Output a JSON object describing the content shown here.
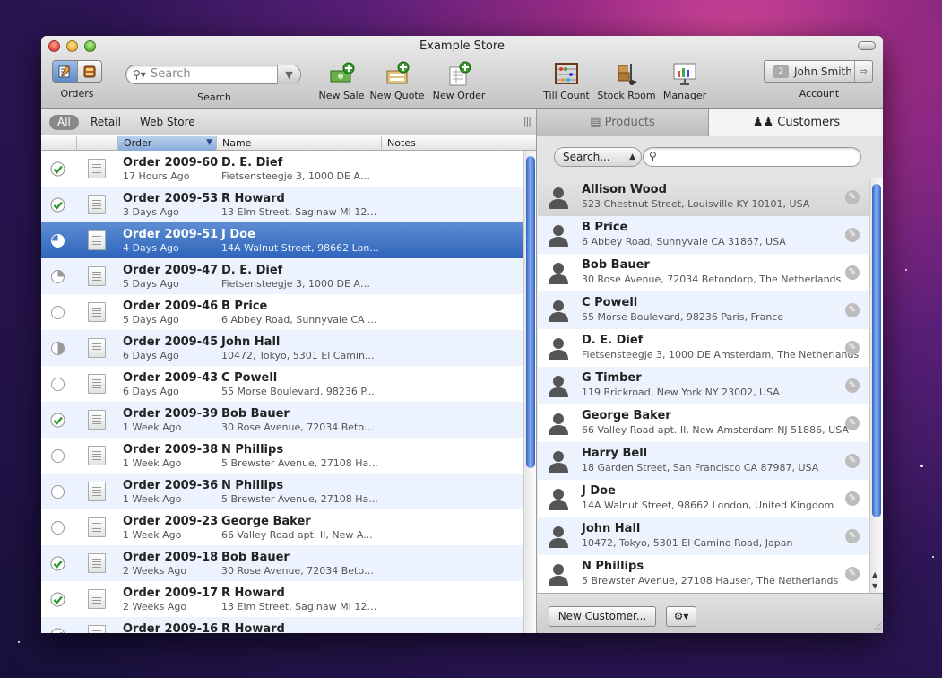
{
  "window": {
    "title": "Example Store"
  },
  "toolbar": {
    "orders_label": "Orders",
    "search_label": "Search",
    "search_placeholder": "Search",
    "new_sale_label": "New Sale",
    "new_quote_label": "New Quote",
    "new_order_label": "New Order",
    "till_count_label": "Till Count",
    "stock_room_label": "Stock Room",
    "manager_label": "Manager",
    "account_label": "Account",
    "account_user": "John Smith",
    "account_badge": "2"
  },
  "scope_bar": {
    "all": "All",
    "retail": "Retail",
    "web_store": "Web Store"
  },
  "orders_table": {
    "columns": {
      "order": "Order",
      "name": "Name",
      "notes": "Notes"
    },
    "rows": [
      {
        "status": "complete",
        "order": "Order 2009-60",
        "ago": "17 Hours Ago",
        "name": "D. E. Dief",
        "address": "Fietsensteegje 3, 1000 DE Am..."
      },
      {
        "status": "complete",
        "order": "Order 2009-53",
        "ago": "3 Days Ago",
        "name": "R Howard",
        "address": "13 Elm Street, Saginaw MI 127..."
      },
      {
        "status": "three-quarter",
        "order": "Order 2009-51",
        "ago": "4 Days Ago",
        "name": "J Doe",
        "address": "14A Walnut Street, 98662 Lon...",
        "selected": true
      },
      {
        "status": "quarter",
        "order": "Order 2009-47",
        "ago": "5 Days Ago",
        "name": "D. E. Dief",
        "address": "Fietsensteegje 3, 1000 DE Am..."
      },
      {
        "status": "empty",
        "order": "Order 2009-46",
        "ago": "5 Days Ago",
        "name": "B Price",
        "address": "6 Abbey Road, Sunnyvale CA ..."
      },
      {
        "status": "half",
        "order": "Order 2009-45",
        "ago": "6 Days Ago",
        "name": "John Hall",
        "address": "10472, Tokyo, 5301 El Camin..."
      },
      {
        "status": "empty",
        "order": "Order 2009-43",
        "ago": "6 Days Ago",
        "name": "C Powell",
        "address": "55 Morse Boulevard, 98236 P..."
      },
      {
        "status": "complete",
        "order": "Order 2009-39",
        "ago": "1 Week Ago",
        "name": "Bob Bauer",
        "address": "30 Rose Avenue, 72034 Beton..."
      },
      {
        "status": "empty",
        "order": "Order 2009-38",
        "ago": "1 Week Ago",
        "name": "N Phillips",
        "address": "5 Brewster Avenue, 27108 Ha..."
      },
      {
        "status": "empty",
        "order": "Order 2009-36",
        "ago": "1 Week Ago",
        "name": "N Phillips",
        "address": "5 Brewster Avenue, 27108 Ha..."
      },
      {
        "status": "empty",
        "order": "Order 2009-23",
        "ago": "1 Week Ago",
        "name": "George Baker",
        "address": "66 Valley Road apt. II, New A..."
      },
      {
        "status": "complete",
        "order": "Order 2009-18",
        "ago": "2 Weeks Ago",
        "name": "Bob Bauer",
        "address": "30 Rose Avenue, 72034 Beton..."
      },
      {
        "status": "complete",
        "order": "Order 2009-17",
        "ago": "2 Weeks Ago",
        "name": "R Howard",
        "address": "13 Elm Street, Saginaw MI 127..."
      },
      {
        "status": "complete",
        "order": "Order 2009-16",
        "ago": "",
        "name": "R Howard",
        "address": ""
      }
    ]
  },
  "right_pane": {
    "tab_products": "Products",
    "tab_customers": "Customers",
    "search_scope": "Search...",
    "customers": [
      {
        "name": "Allison Wood",
        "address": "523 Chestnut Street, Louisville KY 10101, USA"
      },
      {
        "name": "B Price",
        "address": "6 Abbey Road, Sunnyvale CA 31867, USA"
      },
      {
        "name": "Bob Bauer",
        "address": "30 Rose Avenue, 72034 Betondorp, The Netherlands"
      },
      {
        "name": "C Powell",
        "address": "55 Morse Boulevard, 98236 Paris, France"
      },
      {
        "name": "D. E. Dief",
        "address": "Fietsensteegje 3, 1000 DE Amsterdam, The Netherlands"
      },
      {
        "name": "G Timber",
        "address": "119 Brickroad, New York NY 23002, USA"
      },
      {
        "name": "George Baker",
        "address": "66 Valley Road apt. II, New Amsterdam NJ 51886, USA"
      },
      {
        "name": "Harry Bell",
        "address": "18 Garden Street, San Francisco CA 87987, USA"
      },
      {
        "name": "J Doe",
        "address": "14A Walnut Street, 98662 London, United Kingdom"
      },
      {
        "name": "John Hall",
        "address": "10472, Tokyo, 5301 El Camino Road, Japan"
      },
      {
        "name": "N Phillips",
        "address": "5 Brewster Avenue, 27108 Hauser, The Netherlands"
      }
    ],
    "new_customer_button": "New Customer..."
  }
}
